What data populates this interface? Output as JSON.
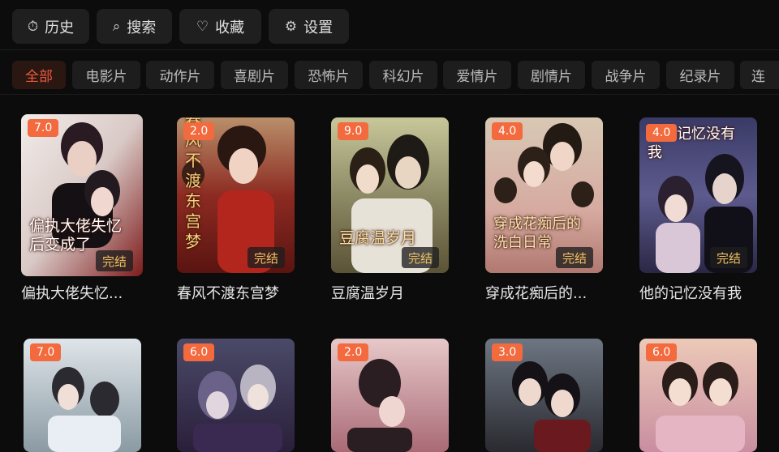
{
  "nav": [
    {
      "icon": "clock-icon",
      "glyph": "⏱",
      "label": "历史"
    },
    {
      "icon": "search-icon",
      "glyph": "⌕",
      "label": "搜索"
    },
    {
      "icon": "heart-icon",
      "glyph": "♡",
      "label": "收藏"
    },
    {
      "icon": "gear-icon",
      "glyph": "⚙",
      "label": "设置"
    }
  ],
  "categories": [
    "全部",
    "电影片",
    "动作片",
    "喜剧片",
    "恐怖片",
    "科幻片",
    "爱情片",
    "剧情片",
    "战争片",
    "纪录片",
    "连"
  ],
  "active_category": "全部",
  "colors": {
    "accent": "#ef5a3c",
    "score_badge": "#f26a3d",
    "status_text": "#f0c060",
    "background": "#0c0c0c"
  },
  "row1": [
    {
      "score": "7.0",
      "status": "完结",
      "poster_text": "偏执大佬失忆后变成了",
      "title": "偏执大佬失忆..."
    },
    {
      "score": "2.0",
      "status": "完结",
      "poster_text": "春风不渡东宫梦",
      "title": "春风不渡东宫梦"
    },
    {
      "score": "9.0",
      "status": "完结",
      "poster_text": "豆腐温岁月",
      "title": "豆腐温岁月"
    },
    {
      "score": "4.0",
      "status": "完结",
      "poster_text": "穿成花痴后的洗白日常",
      "title": "穿成花痴后的..."
    },
    {
      "score": "4.0",
      "status": "完结",
      "poster_text": "他的记忆没有我",
      "title": "他的记忆没有我"
    }
  ],
  "row2": [
    {
      "score": "7.0"
    },
    {
      "score": "6.0"
    },
    {
      "score": "2.0"
    },
    {
      "score": "3.0"
    },
    {
      "score": "6.0"
    }
  ]
}
